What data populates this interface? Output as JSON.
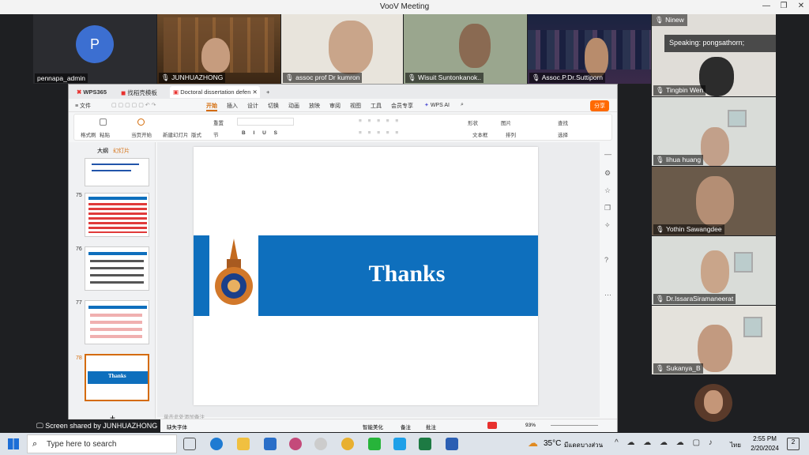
{
  "window": {
    "title": "VooV Meeting"
  },
  "participants": {
    "admin": {
      "name": "pennapa_admin",
      "initial": "P"
    },
    "top": [
      {
        "name": "JUNHUAZHONG"
      },
      {
        "name": "assoc prof Dr kumron"
      },
      {
        "name": "Wisuit Suntonkanok.."
      },
      {
        "name": "Assoc.P.Dr.Suttiporn"
      }
    ],
    "right_header": {
      "name": "Ninew",
      "speaking": "Speaking:  pongsathorn;"
    },
    "right": [
      {
        "name": "Tingbin Wen"
      },
      {
        "name": "lihua huang"
      },
      {
        "name": "Yothin Sawangdee"
      },
      {
        "name": "Dr.IssaraSiramaneerat"
      },
      {
        "name": "Sukanya_B"
      }
    ]
  },
  "screen_share": {
    "label": "Screen shared by JUNHUAZHONG"
  },
  "wps": {
    "tabs": {
      "home": "WPS365",
      "tab2": "找稻壳模板",
      "doc": "Doctoral dissertation defen"
    },
    "file_menu": "文件",
    "menus": [
      "开始",
      "插入",
      "设计",
      "切换",
      "动画",
      "放映",
      "审阅",
      "视图",
      "工具",
      "会员专享"
    ],
    "wps_ai": "WPS AI",
    "share": "分享",
    "ribbon": {
      "format_painter": "格式刷",
      "paste": "粘贴",
      "play": "当页开始",
      "new_slide": "新建幻灯片",
      "layout": "版式",
      "section": "节",
      "reset": "重置",
      "shape": "形状",
      "picture": "图片",
      "find": "查找",
      "textbox": "文本框",
      "arrange": "排列",
      "select": "选择"
    },
    "panel_tabs": {
      "outline": "大纲",
      "slides": "幻灯片"
    },
    "slide_numbers": [
      "75",
      "76",
      "77",
      "78"
    ],
    "thumb_78_text": "Thanks",
    "slide": {
      "title": "Thanks"
    },
    "notes_placeholder": "单击此处添加备注",
    "status": {
      "font_missing": "缺失字体",
      "smart": "智能美化",
      "notes": "备注",
      "comments": "批注",
      "zoom": "93%"
    }
  },
  "taskbar": {
    "search": "Type here to search",
    "weather": "35°C",
    "weather_desc": "มีแดดบางส่วน",
    "lang": "ไทย",
    "time": "2:55 PM",
    "date": "2/20/2024",
    "notifications": "2"
  },
  "colors": {
    "slide_blue": "#0e6fbd",
    "accent_orange": "#ff6a00",
    "wps_red": "#e8312e"
  }
}
